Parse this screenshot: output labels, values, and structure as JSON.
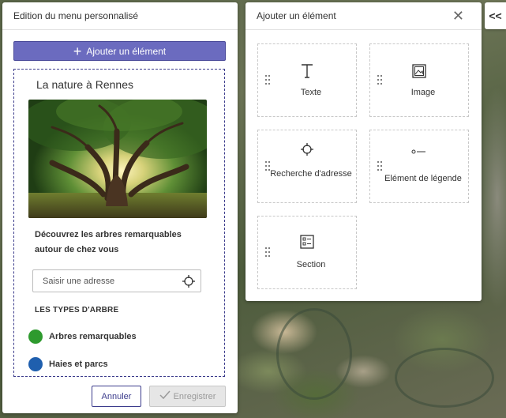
{
  "editor": {
    "title": "Edition du menu personnalisé",
    "add_button_label": "Ajouter un élément",
    "preview": {
      "title": "La nature à Rennes",
      "description": "Découvrez les arbres remarquables autour de chez vous",
      "address_placeholder": "Saisir une adresse",
      "legend_header": "LES TYPES D'ARBRE",
      "legend_items": [
        {
          "label": "Arbres remarquables",
          "color": "#2e9a2e"
        },
        {
          "label": "Haies et parcs",
          "color": "#1f5fae"
        }
      ]
    },
    "cancel_label": "Annuler",
    "save_label": "Enregistrer"
  },
  "add_element": {
    "title": "Ajouter un élément",
    "tiles": [
      {
        "label": "Texte",
        "icon": "text-icon"
      },
      {
        "label": "Image",
        "icon": "image-icon"
      },
      {
        "label": "Recherche d'adresse",
        "icon": "crosshair-icon"
      },
      {
        "label": "Elément de légende",
        "icon": "legend-icon"
      },
      {
        "label": "Section",
        "icon": "section-icon"
      }
    ]
  },
  "collapse_label": "<<",
  "colors": {
    "accent": "#6b6bbf",
    "accent_border": "#3c3c8c"
  }
}
